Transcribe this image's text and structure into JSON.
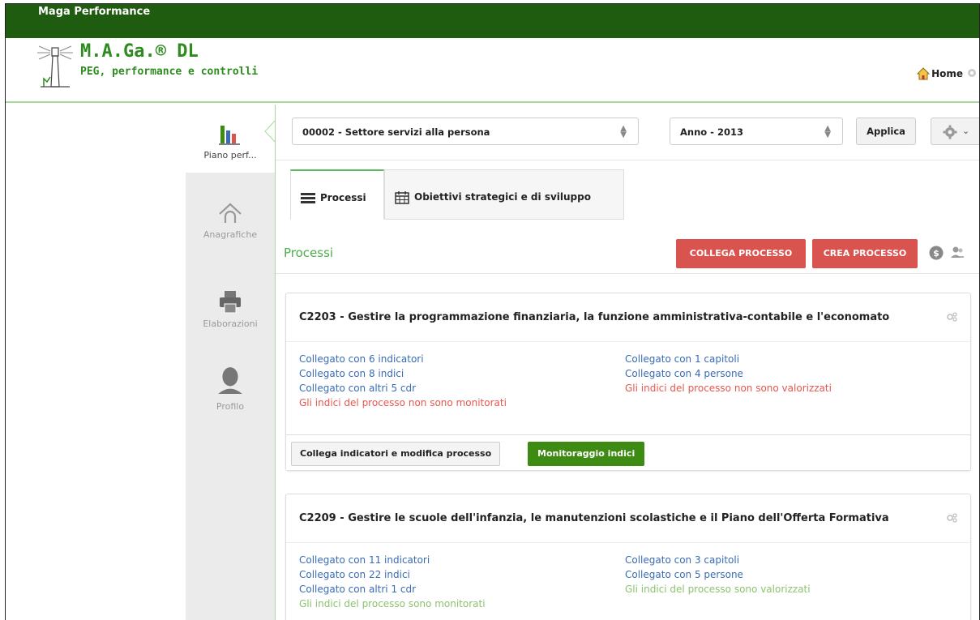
{
  "app": {
    "title": "Maga Performance",
    "logo_title": "M.A.Ga.® DL",
    "logo_subtitle": "PEG, performance e controlli",
    "home_label": "Home"
  },
  "sidenav": {
    "items": [
      {
        "label": "Piano perf...",
        "icon": "bar-chart-icon",
        "active": true
      },
      {
        "label": "Anagrafiche",
        "icon": "home-outline-icon",
        "active": false
      },
      {
        "label": "Elaborazioni",
        "icon": "printer-icon",
        "active": false
      },
      {
        "label": "Profilo",
        "icon": "user-icon",
        "active": false
      }
    ]
  },
  "filters": {
    "sector_value": "00002 - Settore servizi alla persona",
    "year_value": "Anno - 2013",
    "apply_label": "Applica"
  },
  "tabs": [
    {
      "label": "Processi",
      "active": true,
      "icon": "list-icon"
    },
    {
      "label": "Obiettivi strategici e di sviluppo",
      "active": false,
      "icon": "calendar-icon"
    }
  ],
  "section": {
    "title": "Processi",
    "collega_label": "COLLEGA PROCESSO",
    "crea_label": "CREA PROCESSO"
  },
  "colors": {
    "brand_green": "#1f5c0f",
    "accent_green": "#4cae4c",
    "danger_red": "#d9534f",
    "link_blue": "#3a6bb5"
  },
  "processes": [
    {
      "code": "C2203",
      "title": "Gestire la programmazione finanziaria, la funzione amministrativa-contabile e l'economato",
      "left": [
        "Collegato con 6 indicatori",
        "Collegato con 8 indici",
        "Collegato con altri 5 cdr"
      ],
      "left_status": "Gli indici del processo non sono monitorati",
      "right": [
        "Collegato con 1 capitoli",
        "Collegato con 4 persone"
      ],
      "right_status": "Gli indici del processo non sono valorizzati",
      "status_ok": false,
      "edit_label": "Collega indicatori e modifica processo",
      "monitor_label": "Monitoraggio indici"
    },
    {
      "code": "C2209",
      "title": "Gestire le scuole dell'infanzia, le manutenzioni scolastiche e il Piano dell'Offerta Formativa",
      "left": [
        "Collegato con 11 indicatori",
        "Collegato con 22 indici",
        "Collegato con altri 1 cdr"
      ],
      "left_status": "Gli indici del processo sono monitorati",
      "right": [
        "Collegato con 3 capitoli",
        "Collegato con 5 persone"
      ],
      "right_status": "Gli indici del processo sono valorizzati",
      "status_ok": true
    }
  ]
}
